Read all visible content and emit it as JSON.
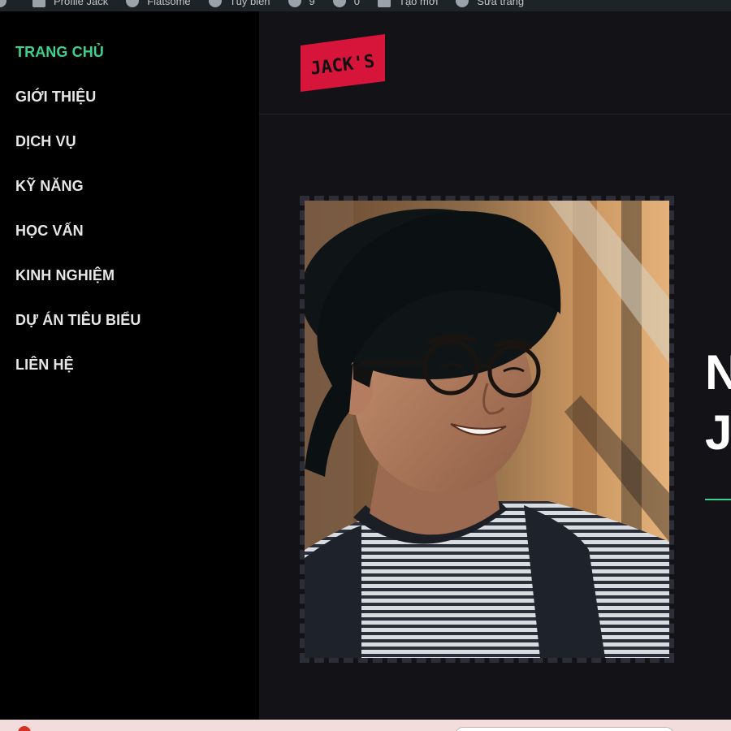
{
  "admin_bar": {
    "items": [
      {
        "label": "",
        "icon": "wordpress-icon"
      },
      {
        "label": "Profile Jack",
        "icon": "home-icon"
      },
      {
        "label": "Flatsome",
        "icon": "theme-icon"
      },
      {
        "label": "Tùy biến",
        "icon": "customize-icon"
      },
      {
        "label": "9",
        "icon": "updates-icon"
      },
      {
        "label": "0",
        "icon": "comments-icon"
      },
      {
        "label": "Tạo mới",
        "icon": "plus-icon"
      },
      {
        "label": "Sửa trang",
        "icon": "edit-icon"
      }
    ]
  },
  "nav": {
    "items": [
      {
        "label": "TRANG CHỦ",
        "active": true
      },
      {
        "label": "GIỚI THIỆU",
        "active": false
      },
      {
        "label": "DỊCH VỤ",
        "active": false
      },
      {
        "label": "KỸ NĂNG",
        "active": false
      },
      {
        "label": "HỌC VẤN",
        "active": false
      },
      {
        "label": "KINH NGHIỆM",
        "active": false
      },
      {
        "label": "DỰ ÁN TIÊU BIỂU",
        "active": false
      },
      {
        "label": "LIÊN HỆ",
        "active": false
      }
    ]
  },
  "logo": {
    "text": "JACK'S",
    "bg_color": "#d7143a",
    "text_color": "#111111"
  },
  "hero": {
    "title_line1": "N",
    "title_line2": "J"
  },
  "colors": {
    "accent": "#3ed18b",
    "sidebar_bg": "#000000",
    "page_bg": "#121217"
  }
}
